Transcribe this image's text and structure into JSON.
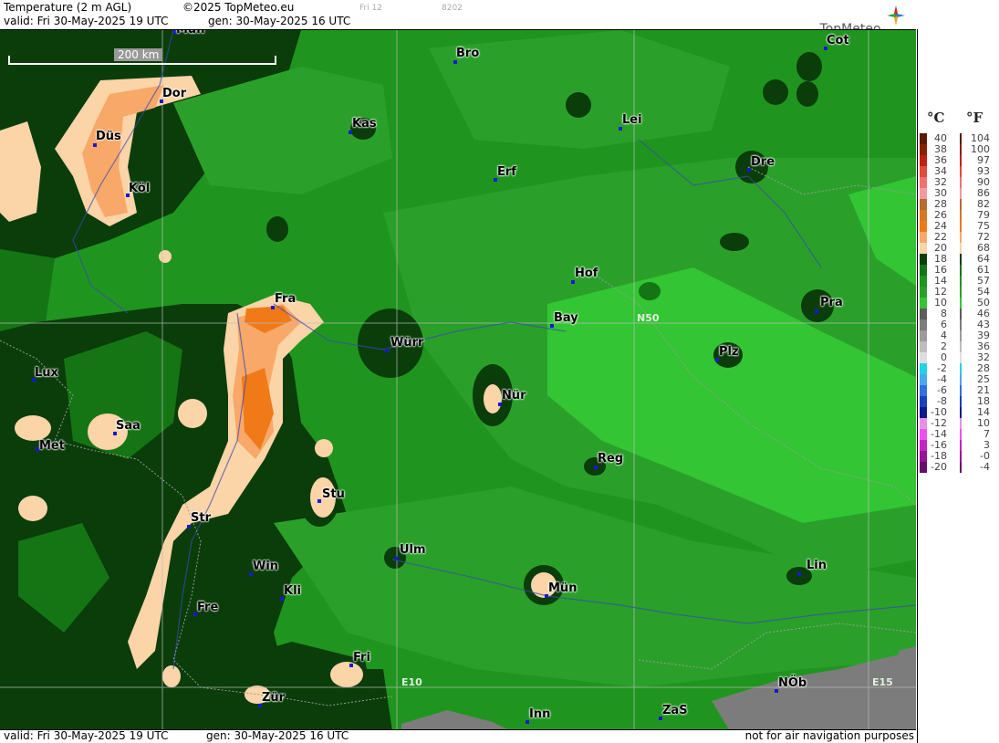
{
  "header": {
    "title": "Temperature (2 m AGL)",
    "copyright": "©2025 TopMeteo.eu",
    "valid": "valid:  Fri  30-May-2025  19 UTC",
    "generated": "gen:  30-May-2025 16 UTC",
    "faint1": "Fri 12",
    "faint2": "8202",
    "brand": "TopMeteo"
  },
  "footer": {
    "valid": "valid:  Fri  30-May-2025  19 UTC",
    "generated": "gen:  30-May-2025 16 UTC",
    "disclaimer": "not for air navigation purposes"
  },
  "map": {
    "scale_label": "200 km",
    "grid_labels": [
      "N50",
      "E10",
      "E15"
    ],
    "cities": [
      {
        "name": "Mün"
      },
      {
        "name": "Dor"
      },
      {
        "name": "Düs"
      },
      {
        "name": "Köl"
      },
      {
        "name": "Bro"
      },
      {
        "name": "Cot"
      },
      {
        "name": "Kas"
      },
      {
        "name": "Lei"
      },
      {
        "name": "Erf"
      },
      {
        "name": "Dre"
      },
      {
        "name": "Fra"
      },
      {
        "name": "Hof"
      },
      {
        "name": "Bay"
      },
      {
        "name": "Pra"
      },
      {
        "name": "Würr"
      },
      {
        "name": "Lux"
      },
      {
        "name": "Plz"
      },
      {
        "name": "Nür"
      },
      {
        "name": "Saa"
      },
      {
        "name": "Met"
      },
      {
        "name": "Reg"
      },
      {
        "name": "Stu"
      },
      {
        "name": "Str"
      },
      {
        "name": "Ulm"
      },
      {
        "name": "Win"
      },
      {
        "name": "Kli"
      },
      {
        "name": "Mün"
      },
      {
        "name": "Lin"
      },
      {
        "name": "Fre"
      },
      {
        "name": "Fri"
      },
      {
        "name": "NÖb"
      },
      {
        "name": "Zür"
      },
      {
        "name": "ZaS"
      },
      {
        "name": "Inn"
      }
    ]
  },
  "legend": {
    "unit_c": "°C",
    "unit_f": "°F",
    "rows": [
      {
        "c": "40",
        "f": "104",
        "color": "#5a1a00"
      },
      {
        "c": "38",
        "f": "100",
        "color": "#8a2000"
      },
      {
        "c": "36",
        "f": "97",
        "color": "#c02010"
      },
      {
        "c": "34",
        "f": "93",
        "color": "#e04a3a"
      },
      {
        "c": "32",
        "f": "90",
        "color": "#f27070"
      },
      {
        "c": "30",
        "f": "86",
        "color": "#f39aa0"
      },
      {
        "c": "28",
        "f": "82",
        "color": "#b86a30"
      },
      {
        "c": "26",
        "f": "79",
        "color": "#d7771f"
      },
      {
        "c": "24",
        "f": "75",
        "color": "#f07a18"
      },
      {
        "c": "22",
        "f": "72",
        "color": "#f8a868"
      },
      {
        "c": "20",
        "f": "68",
        "color": "#fbd4a8"
      },
      {
        "c": "18",
        "f": "64",
        "color": "#0a3d0a"
      },
      {
        "c": "16",
        "f": "61",
        "color": "#157515"
      },
      {
        "c": "14",
        "f": "57",
        "color": "#1f951f"
      },
      {
        "c": "12",
        "f": "54",
        "color": "#2aa02a"
      },
      {
        "c": "10",
        "f": "50",
        "color": "#33c533"
      },
      {
        "c": "8",
        "f": "46",
        "color": "#5d5d5d"
      },
      {
        "c": "6",
        "f": "43",
        "color": "#7c7c7c"
      },
      {
        "c": "4",
        "f": "39",
        "color": "#9c9c9c"
      },
      {
        "c": "2",
        "f": "36",
        "color": "#bdbdbd"
      },
      {
        "c": "0",
        "f": "32",
        "color": "#dedede"
      },
      {
        "c": "-2",
        "f": "28",
        "color": "#22d2e8"
      },
      {
        "c": "-4",
        "f": "25",
        "color": "#4aa8f0"
      },
      {
        "c": "-6",
        "f": "21",
        "color": "#3070e0"
      },
      {
        "c": "-8",
        "f": "18",
        "color": "#1840c0"
      },
      {
        "c": "-10",
        "f": "14",
        "color": "#101890"
      },
      {
        "c": "-12",
        "f": "10",
        "color": "#e890e8"
      },
      {
        "c": "-14",
        "f": "7",
        "color": "#f050f0"
      },
      {
        "c": "-16",
        "f": "3",
        "color": "#c820c8"
      },
      {
        "c": "-18",
        "f": "-0",
        "color": "#9a109a"
      },
      {
        "c": "-20",
        "f": "-4",
        "color": "#6a0a6a"
      }
    ]
  }
}
